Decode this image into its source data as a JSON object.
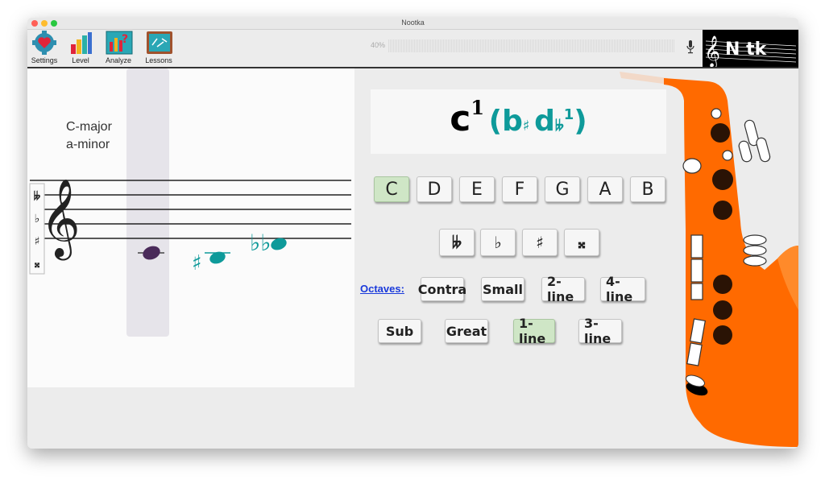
{
  "window": {
    "title": "Nootka"
  },
  "toolbar": {
    "items": [
      {
        "label": "Settings",
        "icon": "settings-icon"
      },
      {
        "label": "Level",
        "icon": "level-icon"
      },
      {
        "label": "Analyze",
        "icon": "analyze-icon"
      },
      {
        "label": "Lessons",
        "icon": "lessons-icon"
      }
    ],
    "volume_label": "40%",
    "logo_text": "N  tk"
  },
  "score": {
    "key_major": "C-major",
    "key_minor": "a-minor",
    "accidental_palette": [
      "𝄫",
      "♭",
      "♯",
      "𝄪"
    ]
  },
  "note_name": {
    "main_letter": "c",
    "main_octave": "1",
    "open_paren": "(",
    "alt1_letter": "b",
    "alt1_accidental": "♯",
    "alt2_letter": "d",
    "alt2_accidental": "𝄫",
    "alt2_octave": "1",
    "close_paren": ")"
  },
  "note_buttons": [
    {
      "label": "C",
      "selected": true
    },
    {
      "label": "D",
      "selected": false
    },
    {
      "label": "E",
      "selected": false
    },
    {
      "label": "F",
      "selected": false
    },
    {
      "label": "G",
      "selected": false
    },
    {
      "label": "A",
      "selected": false
    },
    {
      "label": "B",
      "selected": false
    }
  ],
  "accidental_buttons": [
    "𝄫",
    "♭",
    "♯",
    "𝄪"
  ],
  "octaves": {
    "label": "Octaves:",
    "row1": [
      {
        "label": "Contra",
        "selected": false
      },
      {
        "label": "Small",
        "selected": false
      },
      {
        "label": "2-line",
        "selected": false
      },
      {
        "label": "4-line",
        "selected": false
      }
    ],
    "row2": [
      {
        "label": "Sub",
        "selected": false
      },
      {
        "label": "Great",
        "selected": false
      },
      {
        "label": "1-line",
        "selected": true
      },
      {
        "label": "3-line",
        "selected": false
      }
    ]
  },
  "colors": {
    "accent_teal": "#0e9a9a",
    "selected_bg": "#cfe6c6",
    "sax_orange": "#ff6a00",
    "link_blue": "#1a3adb"
  }
}
